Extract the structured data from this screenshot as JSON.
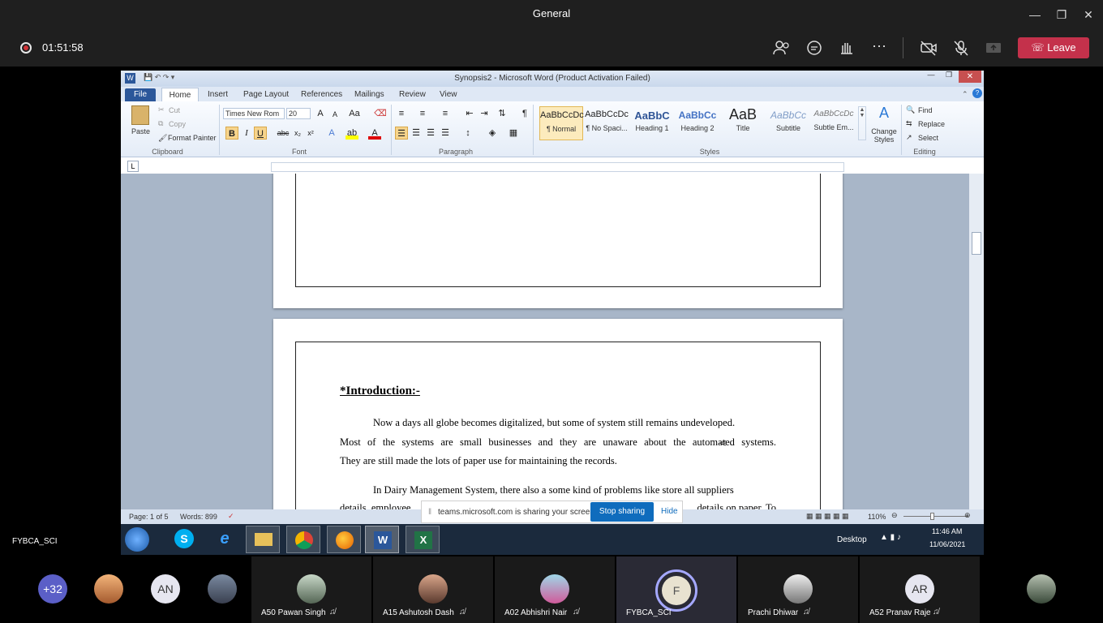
{
  "meeting": {
    "title": "General",
    "timer": "01:51:58",
    "leave_label": "Leave",
    "presenter_name": "FYBCA_SCI"
  },
  "word": {
    "title": "Synopsis2 - Microsoft Word (Product Activation Failed)",
    "tabs": [
      "File",
      "Home",
      "Insert",
      "Page Layout",
      "References",
      "Mailings",
      "Review",
      "View"
    ],
    "clipboard": {
      "paste": "Paste",
      "cut": "Cut",
      "copy": "Copy",
      "format_painter": "Format Painter",
      "label": "Clipboard"
    },
    "font": {
      "name": "Times New Rom",
      "size": "20",
      "label": "Font"
    },
    "paragraph_label": "Paragraph",
    "styles": [
      {
        "sample": "AaBbCcDc",
        "name": "¶ Normal"
      },
      {
        "sample": "AaBbCcDc",
        "name": "¶ No Spaci..."
      },
      {
        "sample": "AaBbC",
        "name": "Heading 1"
      },
      {
        "sample": "AaBbCc",
        "name": "Heading 2"
      },
      {
        "sample": "AaB",
        "name": "Title"
      },
      {
        "sample": "AaBbCc",
        "name": "Subtitle"
      },
      {
        "sample": "AaBbCcDc",
        "name": "Subtle Em..."
      }
    ],
    "styles_label": "Styles",
    "change_styles": "Change Styles",
    "editing": {
      "find": "Find",
      "replace": "Replace",
      "select": "Select",
      "label": "Editing"
    },
    "doc": {
      "heading": "*Introduction:-",
      "p1_lines": [
        "Now a days all globe becomes digitalized, but some of system still remains undeveloped.",
        "Most of the systems are small businesses and they  are unaware about the automated systems.",
        "They are still made the lots of paper use for maintaining the records."
      ],
      "p2_line": "In Dairy Management System, there also a some kind of problems like store all suppliers",
      "p2_partial_left": "details, employee",
      "p2_partial_right": "details on paper. To"
    },
    "status": {
      "page": "Page: 1 of 5",
      "words": "Words: 899",
      "zoom": "110%"
    },
    "taskbar": {
      "desktop": "Desktop",
      "time": "11:46 AM",
      "date": "11/06/2021"
    }
  },
  "share": {
    "message": "teams.microsoft.com is sharing your screen.",
    "stop": "Stop sharing",
    "hide": "Hide"
  },
  "participants": {
    "overflow": "+32",
    "small": [
      {
        "initials": ""
      },
      {
        "initials": "AN"
      },
      {
        "initials": ""
      }
    ],
    "tiles": [
      {
        "name": "A50 Pawan Singh",
        "initials": ""
      },
      {
        "name": "A15 Ashutosh Dash",
        "initials": ""
      },
      {
        "name": "A02 Abhishri Nair",
        "initials": ""
      },
      {
        "name": "FYBCA_SCI",
        "initials": "F"
      },
      {
        "name": "Prachi Dhiwar",
        "initials": ""
      },
      {
        "name": "A52 Pranav Raje",
        "initials": "AR"
      }
    ]
  }
}
